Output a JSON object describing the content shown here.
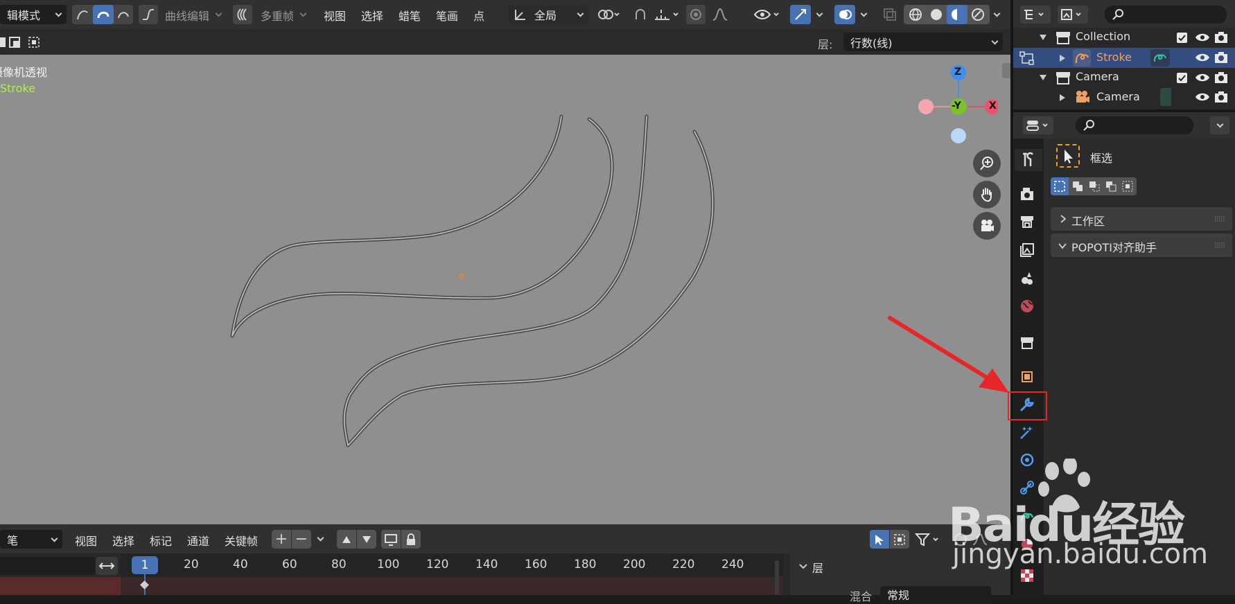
{
  "header": {
    "mode": "辑模式",
    "curve_edit": "曲线编辑",
    "multiframe": "多重帧",
    "menus": [
      "视图",
      "选择",
      "蜡笔",
      "笔画",
      "点"
    ],
    "orientation": "全局"
  },
  "subheader": {
    "layer_label": "层:",
    "layer_value": "行数(线)"
  },
  "viewport": {
    "overlay_title": "摄像机透视",
    "overlay_object": "Stroke",
    "gizmo_axes": {
      "z": "Z",
      "neg_y": "-Y",
      "x": "X"
    },
    "bg": "#8f8f8f"
  },
  "outliner": {
    "rows": [
      {
        "label": "Collection",
        "color": "#e5e5e5"
      },
      {
        "label": "Stroke",
        "color": "#f0a060"
      },
      {
        "label": "Camera",
        "color": "#e5e5e5"
      },
      {
        "label": "Camera",
        "color": "#e5e5e5"
      }
    ]
  },
  "properties": {
    "tool_label": "框选",
    "panels": [
      {
        "label": "工作区"
      },
      {
        "label": "POPOTI对齐助手"
      }
    ]
  },
  "timeline": {
    "mode": "笔",
    "menus": [
      "视图",
      "选择",
      "标记",
      "通道",
      "关键帧"
    ],
    "current_frame": "1",
    "ticks": [
      "20",
      "40",
      "60",
      "80",
      "100",
      "120",
      "140",
      "160",
      "180",
      "200",
      "220",
      "240"
    ],
    "side_panel_title": "层",
    "blend_label": "混合",
    "blend_value": "常规"
  },
  "watermark": {
    "brand": "Baidu经验",
    "url": "jingyan.baidu.com"
  },
  "colors": {
    "accent": "#4772b3",
    "highlight_box": "#e8262a",
    "arrow": "#e8262a"
  }
}
